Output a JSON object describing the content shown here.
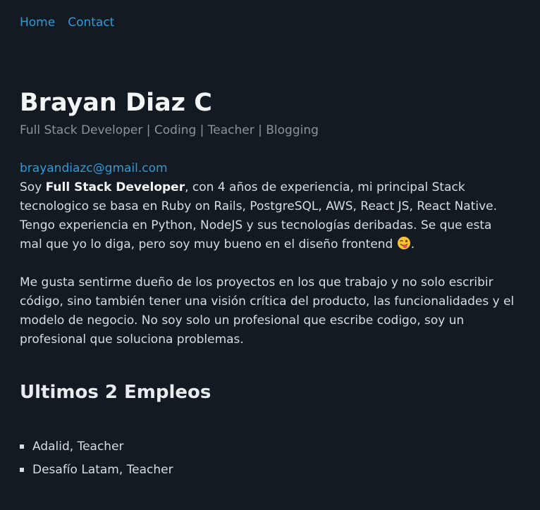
{
  "nav": {
    "home": "Home",
    "contact": "Contact"
  },
  "profile": {
    "name": "Brayan Diaz C",
    "tagline": "Full Stack Developer | Coding | Teacher | Blogging",
    "email": "brayandiazc@gmail.com"
  },
  "bio": {
    "p1_intro": "Soy ",
    "p1_bold": "Full Stack Developer",
    "p1_rest": ", con 4 años de experiencia, mi principal Stack tecnologico se basa en Ruby on Rails, PostgreSQL, AWS, React JS, React Native. Tengo experiencia en Python, NodeJS y sus tecnologías deribadas. Se que esta mal que yo lo diga, pero soy muy bueno en el diseño frontend ",
    "p1_end": ".",
    "p1_emoji": "winking-tongue-face-icon",
    "p2": "Me gusta sentirme dueño de los proyectos en los que trabajo y no solo escribir código, sino también tener una visión crítica del producto, las funcionalidades y el modelo de negocio. No soy solo un profesional que escribe codigo, soy un profesional que soluciona problemas."
  },
  "jobs": {
    "title": "Ultimos 2 Empleos",
    "items": [
      {
        "label": "Adalid, Teacher"
      },
      {
        "label": "Desafío Latam, Teacher"
      }
    ]
  },
  "colors": {
    "background": "#131a21",
    "link": "#2f9bd6",
    "text": "#d7dde3",
    "muted": "#8b939c"
  }
}
